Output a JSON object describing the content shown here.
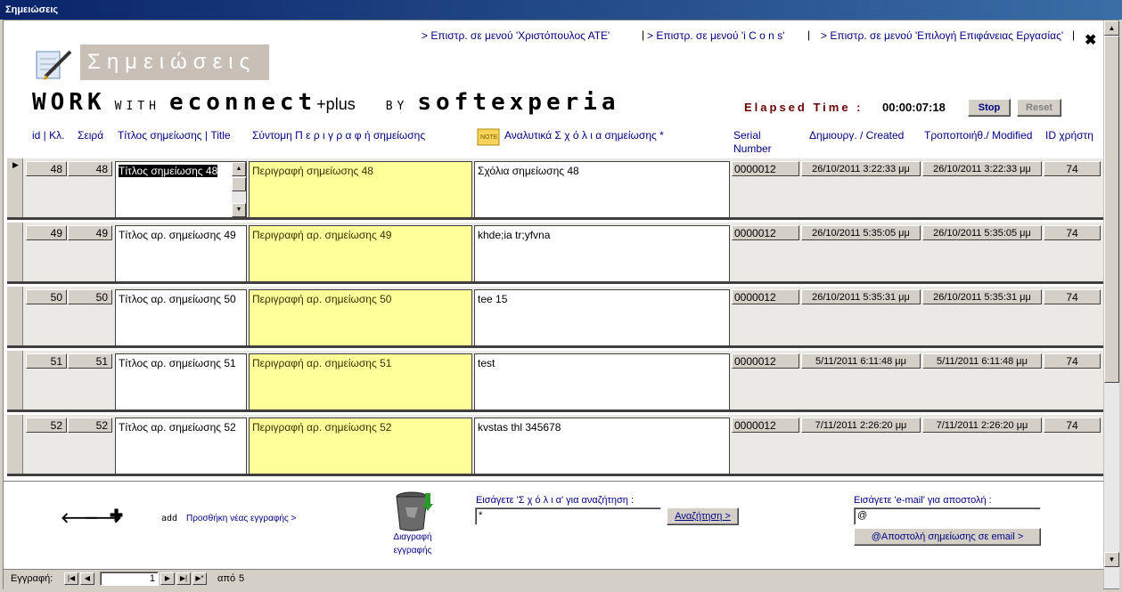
{
  "window": {
    "title": "Σημειώσεις"
  },
  "top_links": [
    "> Επιστρ. σε μενού 'Χριστόπουλος ΑΤΕ'",
    "> Επιστρ. σε μενού  'i C o n s'",
    "> Επιστρ. σε μενού 'Επιλογή Επιφάνειας Εργασίας'"
  ],
  "logo": {
    "title": "Σημειώσεις"
  },
  "brand": {
    "work": "WORK",
    "with": "WITH",
    "econnect": "econnect",
    "plus": "+plus",
    "by": "BY",
    "softexperia": "softexperia"
  },
  "timer": {
    "label": "Elapsed Time :",
    "value": "00:00:07:18",
    "stop_label": "Stop",
    "reset_label": "Reset"
  },
  "columns": {
    "id": "id | Κλ.",
    "order": "Σειρά",
    "title": "Τίτλος σημείωσης | Title",
    "description": "Σύντομη Π ε ρ ι γ ρ α φ ή σημείωσης",
    "comments": "Αναλυτικά Σ χ ό λ ι α σημείωσης *",
    "serial": "Serial Number",
    "created": "Δημιουργ. / Created",
    "modified": "Τροποποιήθ./ Modified",
    "user_id": "ID χρήστη"
  },
  "records": [
    {
      "id": "48",
      "order": "48",
      "title": "Τίτλος σημείωσης 48",
      "description": "Περιγραφή σημείωσης 48",
      "comments": "Σχόλια σημείωσης 48",
      "serial": "0000012",
      "created": "26/10/2011 3:22:33 μμ",
      "modified": "26/10/2011 3:22:33 μμ",
      "user_id": "74"
    },
    {
      "id": "49",
      "order": "49",
      "title": "Τίτλος αρ. σημείωσης 49",
      "description": "Περιγραφή αρ. σημείωσης 49",
      "comments": "khde;ia tr;yfvna",
      "serial": "0000012",
      "created": "26/10/2011 5:35:05 μμ",
      "modified": "26/10/2011 5:35:05 μμ",
      "user_id": "74"
    },
    {
      "id": "50",
      "order": "50",
      "title": "Τίτλος αρ. σημείωσης 50",
      "description": "Περιγραφή αρ. σημείωσης 50",
      "comments": "tee 15",
      "serial": "0000012",
      "created": "26/10/2011 5:35:31 μμ",
      "modified": "26/10/2011 5:35:31 μμ",
      "user_id": "74"
    },
    {
      "id": "51",
      "order": "51",
      "title": "Τίτλος αρ. σημείωσης 51",
      "description": "Περιγραφή αρ. σημείωσης 51",
      "comments": "test",
      "serial": "0000012",
      "created": "5/11/2011 6:11:48 μμ",
      "modified": "5/11/2011 6:11:48 μμ",
      "user_id": "74"
    },
    {
      "id": "52",
      "order": "52",
      "title": "Τίτλος αρ. σημείωσης 52",
      "description": "Περιγραφή αρ. σημείωσης 52",
      "comments": "kvstas thl 345678",
      "serial": "0000012",
      "created": "7/11/2011 2:26:20 μμ",
      "modified": "7/11/2011 2:26:20 μμ",
      "user_id": "74"
    }
  ],
  "footer": {
    "add_label": "add",
    "add_link": "Προσθήκη νέας εγγραφής  >",
    "delete_label_1": "Διαγραφή",
    "delete_label_2": "εγγραφής",
    "search_label": "Εισάγετε 'Σ χ ό λ ι α' για αναζήτηση :",
    "search_value": "*",
    "search_button": "Αναζήτηση >",
    "email_label": "Εισάγετε 'e-mail' για αποστολή :",
    "email_value": "@",
    "email_button": "@Αποστολή σημείωσης σε email >"
  },
  "record_nav": {
    "label": "Εγγραφή:",
    "current": "1",
    "of": "από",
    "total": "5"
  }
}
